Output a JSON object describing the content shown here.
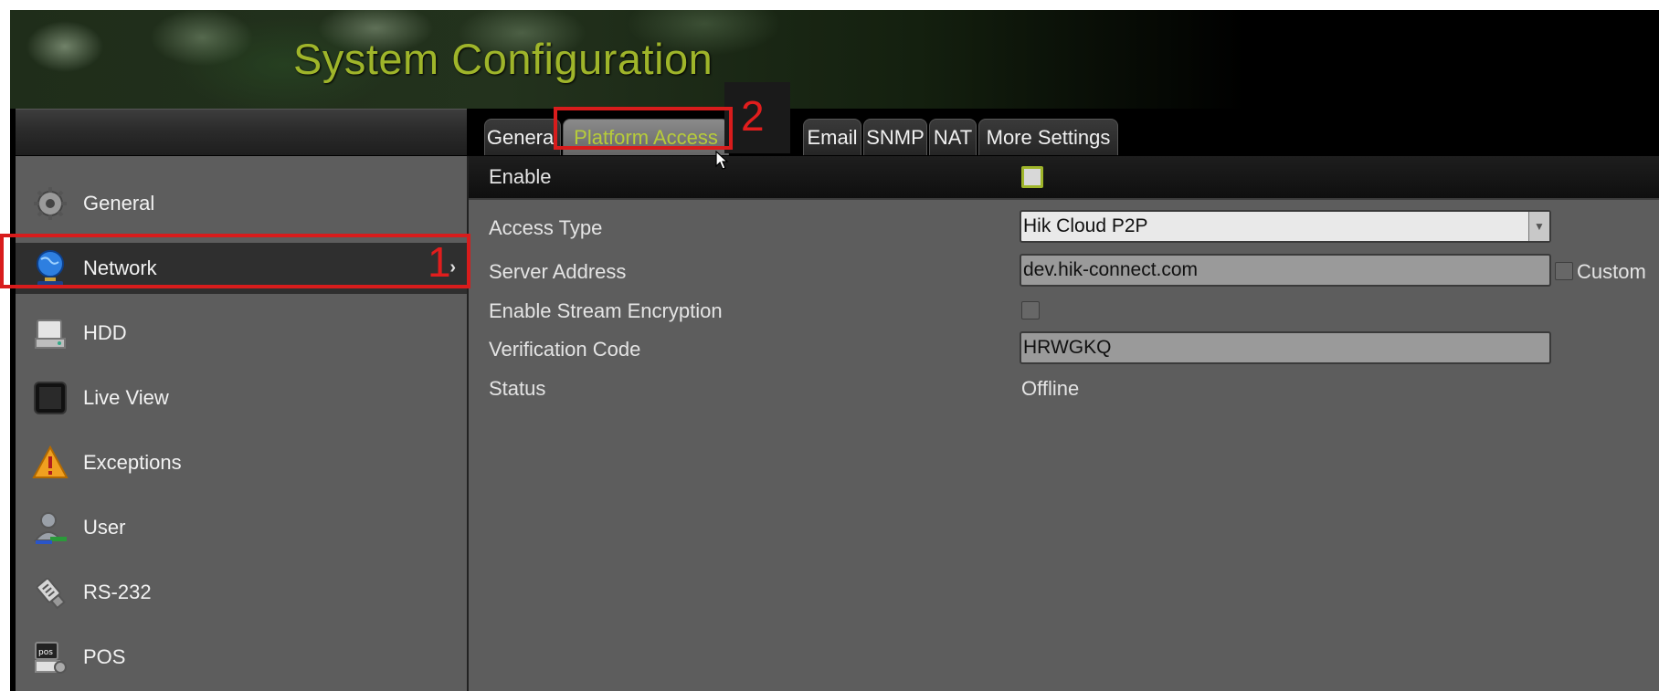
{
  "page": {
    "title": "System Configuration"
  },
  "sidebar": {
    "items": [
      {
        "label": "General",
        "icon": "gear-icon"
      },
      {
        "label": "Network",
        "icon": "globe-icon"
      },
      {
        "label": "HDD",
        "icon": "hdd-icon"
      },
      {
        "label": "Live View",
        "icon": "monitor-icon"
      },
      {
        "label": "Exceptions",
        "icon": "warning-icon"
      },
      {
        "label": "User",
        "icon": "user-icon"
      },
      {
        "label": "RS-232",
        "icon": "plug-icon"
      },
      {
        "label": "POS",
        "icon": "pos-icon"
      }
    ],
    "active_index": 1,
    "chevron": "›",
    "annotation_label": "1",
    "pos_icon_text": "pos"
  },
  "tabs": {
    "items": [
      "General",
      "Platform Access",
      "Email",
      "SNMP",
      "NAT",
      "More Settings"
    ],
    "active_index": 1,
    "annotation_label": "2"
  },
  "form": {
    "enable_label": "Enable",
    "enable_checked": false,
    "access_type_label": "Access Type",
    "access_type_value": "Hik Cloud P2P",
    "server_address_label": "Server Address",
    "server_address_value": "dev.hik-connect.com",
    "custom_label": "Custom",
    "stream_encryption_label": "Enable Stream Encryption",
    "verification_code_label": "Verification Code",
    "verification_code_value": "HRWGKQ",
    "status_label": "Status",
    "status_value": "Offline"
  },
  "colors": {
    "title": "#9fb52a",
    "active_tab_text": "#b7cc3a",
    "annotation": "#d81c1c",
    "panel": "#5d5d5d"
  }
}
